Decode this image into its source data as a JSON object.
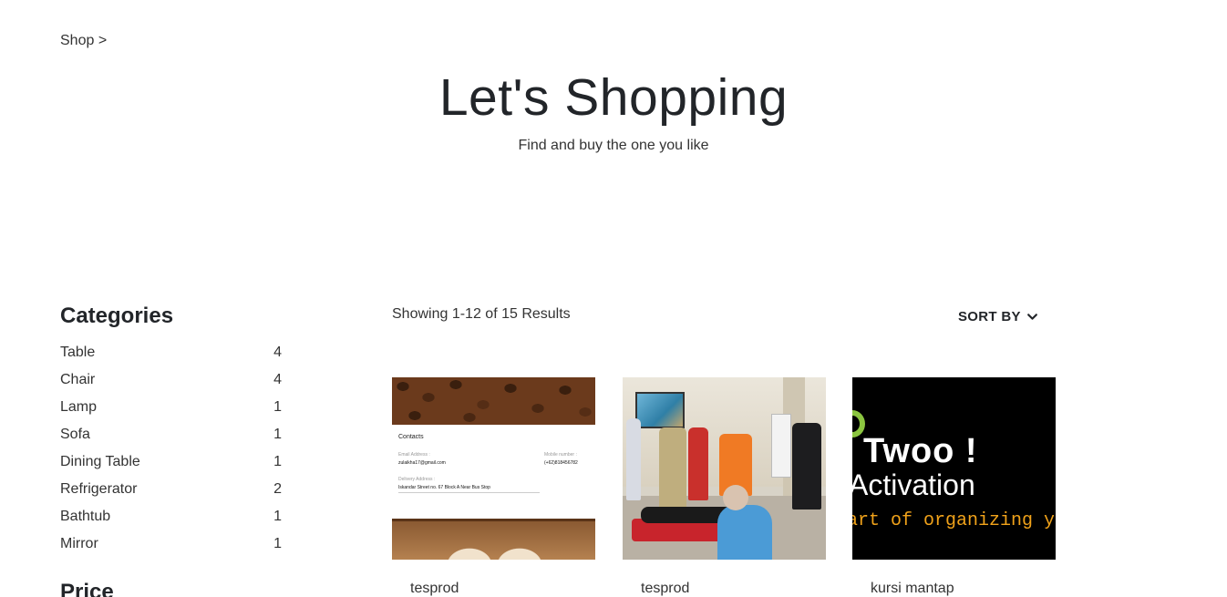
{
  "breadcrumb": {
    "label": "Shop >"
  },
  "hero": {
    "title": "Let's Shopping",
    "subtitle": "Find and buy the one you like"
  },
  "sidebar": {
    "categories_title": "Categories",
    "categories": [
      {
        "label": "Table",
        "count": "4"
      },
      {
        "label": "Chair",
        "count": "4"
      },
      {
        "label": "Lamp",
        "count": "1"
      },
      {
        "label": "Sofa",
        "count": "1"
      },
      {
        "label": "Dining Table",
        "count": "1"
      },
      {
        "label": "Refrigerator",
        "count": "2"
      },
      {
        "label": "Bathtub",
        "count": "1"
      },
      {
        "label": "Mirror",
        "count": "1"
      }
    ],
    "price_title": "Price"
  },
  "toolbar": {
    "results_text": "Showing 1-12 of 15 Results",
    "sort_label": "SORT BY",
    "sort_icon": "chevron-down-icon"
  },
  "products": [
    {
      "name": "tesprod",
      "image_text": {
        "heading": "Contacts",
        "email_label": "Email Address :",
        "email_value": "zulaikha17@gmail.com",
        "mobile_label": "Mobile number :",
        "mobile_value": "(+62)818456782",
        "address_label": "Delivery Address :",
        "address_value": "Iskandar Street no. 67 Block A Near Bus Stop"
      }
    },
    {
      "name": "tesprod"
    },
    {
      "name": "kursi mantap",
      "image_text": {
        "line1": "Twoo !",
        "line2": "Activation",
        "line3": "art of organizing y"
      }
    }
  ]
}
